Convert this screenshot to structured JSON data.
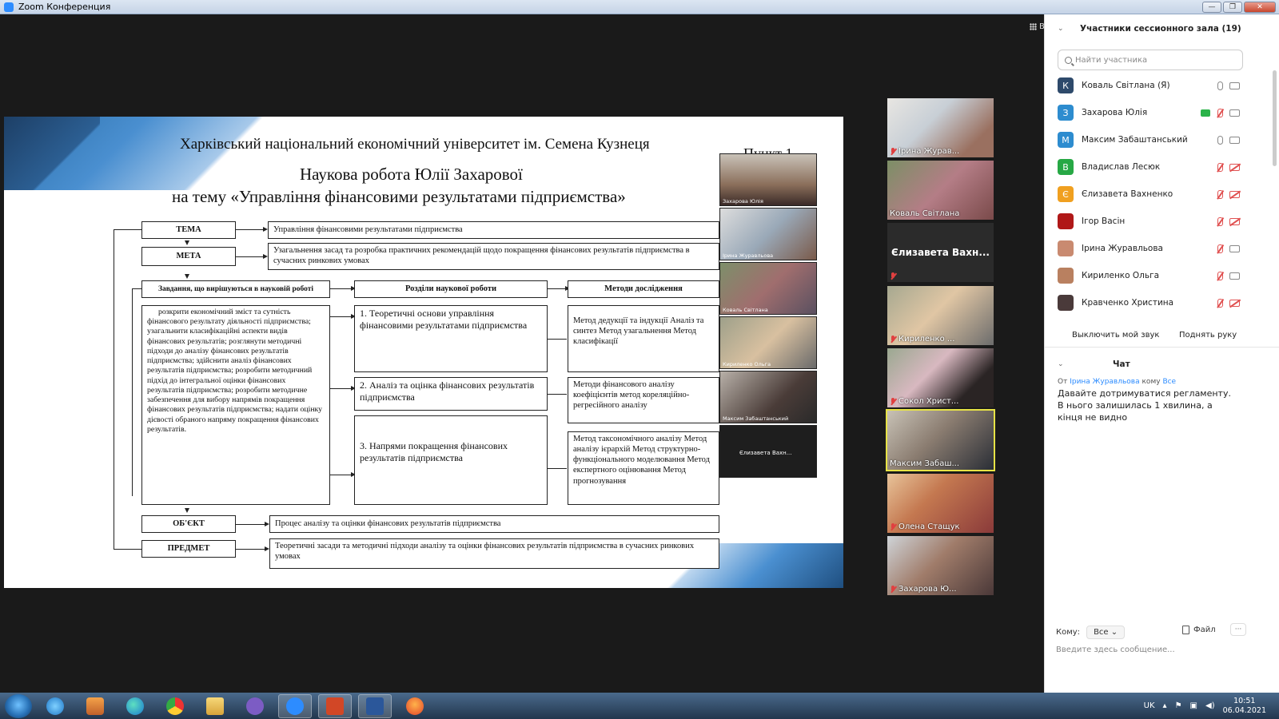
{
  "window": {
    "title": "Zoom Конференция"
  },
  "view_button": "Вид",
  "slide": {
    "university": "Харківський національний економічний університет ім. Семена Кузнеця",
    "title_line1": "Наукова робота Юлії Захарової",
    "title_line2": "на тему «Управління фінансовими результатами підприємства»",
    "point": "Пункт 1",
    "tema_label": "ТЕМА",
    "tema_text": "Управління фінансовими результатами підприємства",
    "meta_label": "МЕТА",
    "meta_text": "Узагальнення засад та розробка практичних рекомендацій щодо покращення фінансових результатів підприємства в сучасних ринкових умовах",
    "tasks_header": "Завдання, що вирішуються в науковій роботі",
    "sections_header": "Розділи наукової роботи",
    "methods_header": "Методи дослідження",
    "tasks_text": "розкрити економічний зміст та сутність фінансового результату діяльності підприємства; узагальнити класифікаційні аспекти видів фінансових результатів; розглянути методичні підходи до аналізу фінансових результатів підприємства; здійснити аналіз фінансових результатів підприємства; розробити методичний підхід до інтегральної оцінки фінансових результатів підприємства; розробити методичне забезпечення для вибору напрямів покращення фінансових результатів підприємства; надати оцінку дієвості обраного напряму покращення фінансових результатів.",
    "section1": "1. Теоретичні основи управління фінансовими результатами підприємства",
    "section2": "2. Аналіз та оцінка фінансових результатів підприємства",
    "section3": "3. Напрями покращення фінансових результатів підприємства",
    "methods1": "Метод дедукції та індукції Аналіз та синтез Метод узагальнення Метод класифікації",
    "methods2": "Методи фінансового аналізу коефіцієнтів метод кореляційно-регресійного аналізу",
    "methods3": "Метод таксономічного аналізу Метод аналізу ієрархій Метод структурно-функціонального моделювання Метод експертного оцінювання Метод прогнозування",
    "object_label": "ОБ'ЄКТ",
    "object_text": "Процес аналізу та оцінки фінансових результатів підприємства",
    "subject_label": "ПРЕДМЕТ",
    "subject_text": "Теоретичні засади та методичні підходи аналізу та оцінки фінансових результатів підприємства в сучасних ринкових умовах"
  },
  "slide_videos": [
    "Захарова Юлія",
    "Ірина Журавльова",
    "Коваль Світлана",
    "Кириленко Ольга",
    "Максим Забаштанський",
    "Єлизавета Вахн..."
  ],
  "gallery": [
    {
      "name": "Ірина Журав...",
      "muted": true
    },
    {
      "name": "Коваль Світлана",
      "muted": false
    },
    {
      "name": "Єлизавета Вахн...",
      "muted": true,
      "no_video": true
    },
    {
      "name": "Кириленко ...",
      "muted": true
    },
    {
      "name": "Сокол Христ...",
      "muted": true
    },
    {
      "name": "Максим Забаш...",
      "muted": false,
      "active": true
    },
    {
      "name": "Олена Стащук",
      "muted": true
    },
    {
      "name": "Захарова Ю...",
      "muted": true
    }
  ],
  "participants_panel": {
    "title": "Участники сессионного зала (19)",
    "search_placeholder": "Найти участника",
    "participants": [
      {
        "initial": "К",
        "name": "Коваль Світлана (Я)",
        "color": "#2e4a6b"
      },
      {
        "initial": "З",
        "name": "Захарова Юлія",
        "color": "#2d8ccf"
      },
      {
        "initial": "М",
        "name": "Максим Забаштанський",
        "color": "#2d8ccf"
      },
      {
        "initial": "В",
        "name": "Владислав Лесюк",
        "color": "#27a845"
      },
      {
        "initial": "Є",
        "name": "Єлизавета Вахненко",
        "color": "#f0a020"
      },
      {
        "initial": "",
        "name": "Ігор Васін",
        "color": "#b01818"
      },
      {
        "initial": "",
        "name": "Ірина Журавльова",
        "color": "#c98a70"
      },
      {
        "initial": "",
        "name": "Кириленко Ольга",
        "color": "#b98060"
      },
      {
        "initial": "",
        "name": "Кравченко Христина",
        "color": "#4a3a3a"
      }
    ],
    "mute_me": "Выключить мой звук",
    "raise_hand": "Поднять руку"
  },
  "chat": {
    "title": "Чат",
    "from_label": "От",
    "from_name": "Ірина Журавльова",
    "to_label": "кому",
    "to_name": "Все",
    "message": "Давайте дотримуватися регламенту. В нього залишилась 1 хвилина, а кінця не видно",
    "to_field_label": "Кому:",
    "to_field_value": "Все",
    "file_label": "Файл",
    "more_label": "···",
    "input_placeholder": "Введите здесь сообщение..."
  },
  "taskbar": {
    "lang": "UK",
    "time": "10:51",
    "date": "06.04.2021"
  }
}
